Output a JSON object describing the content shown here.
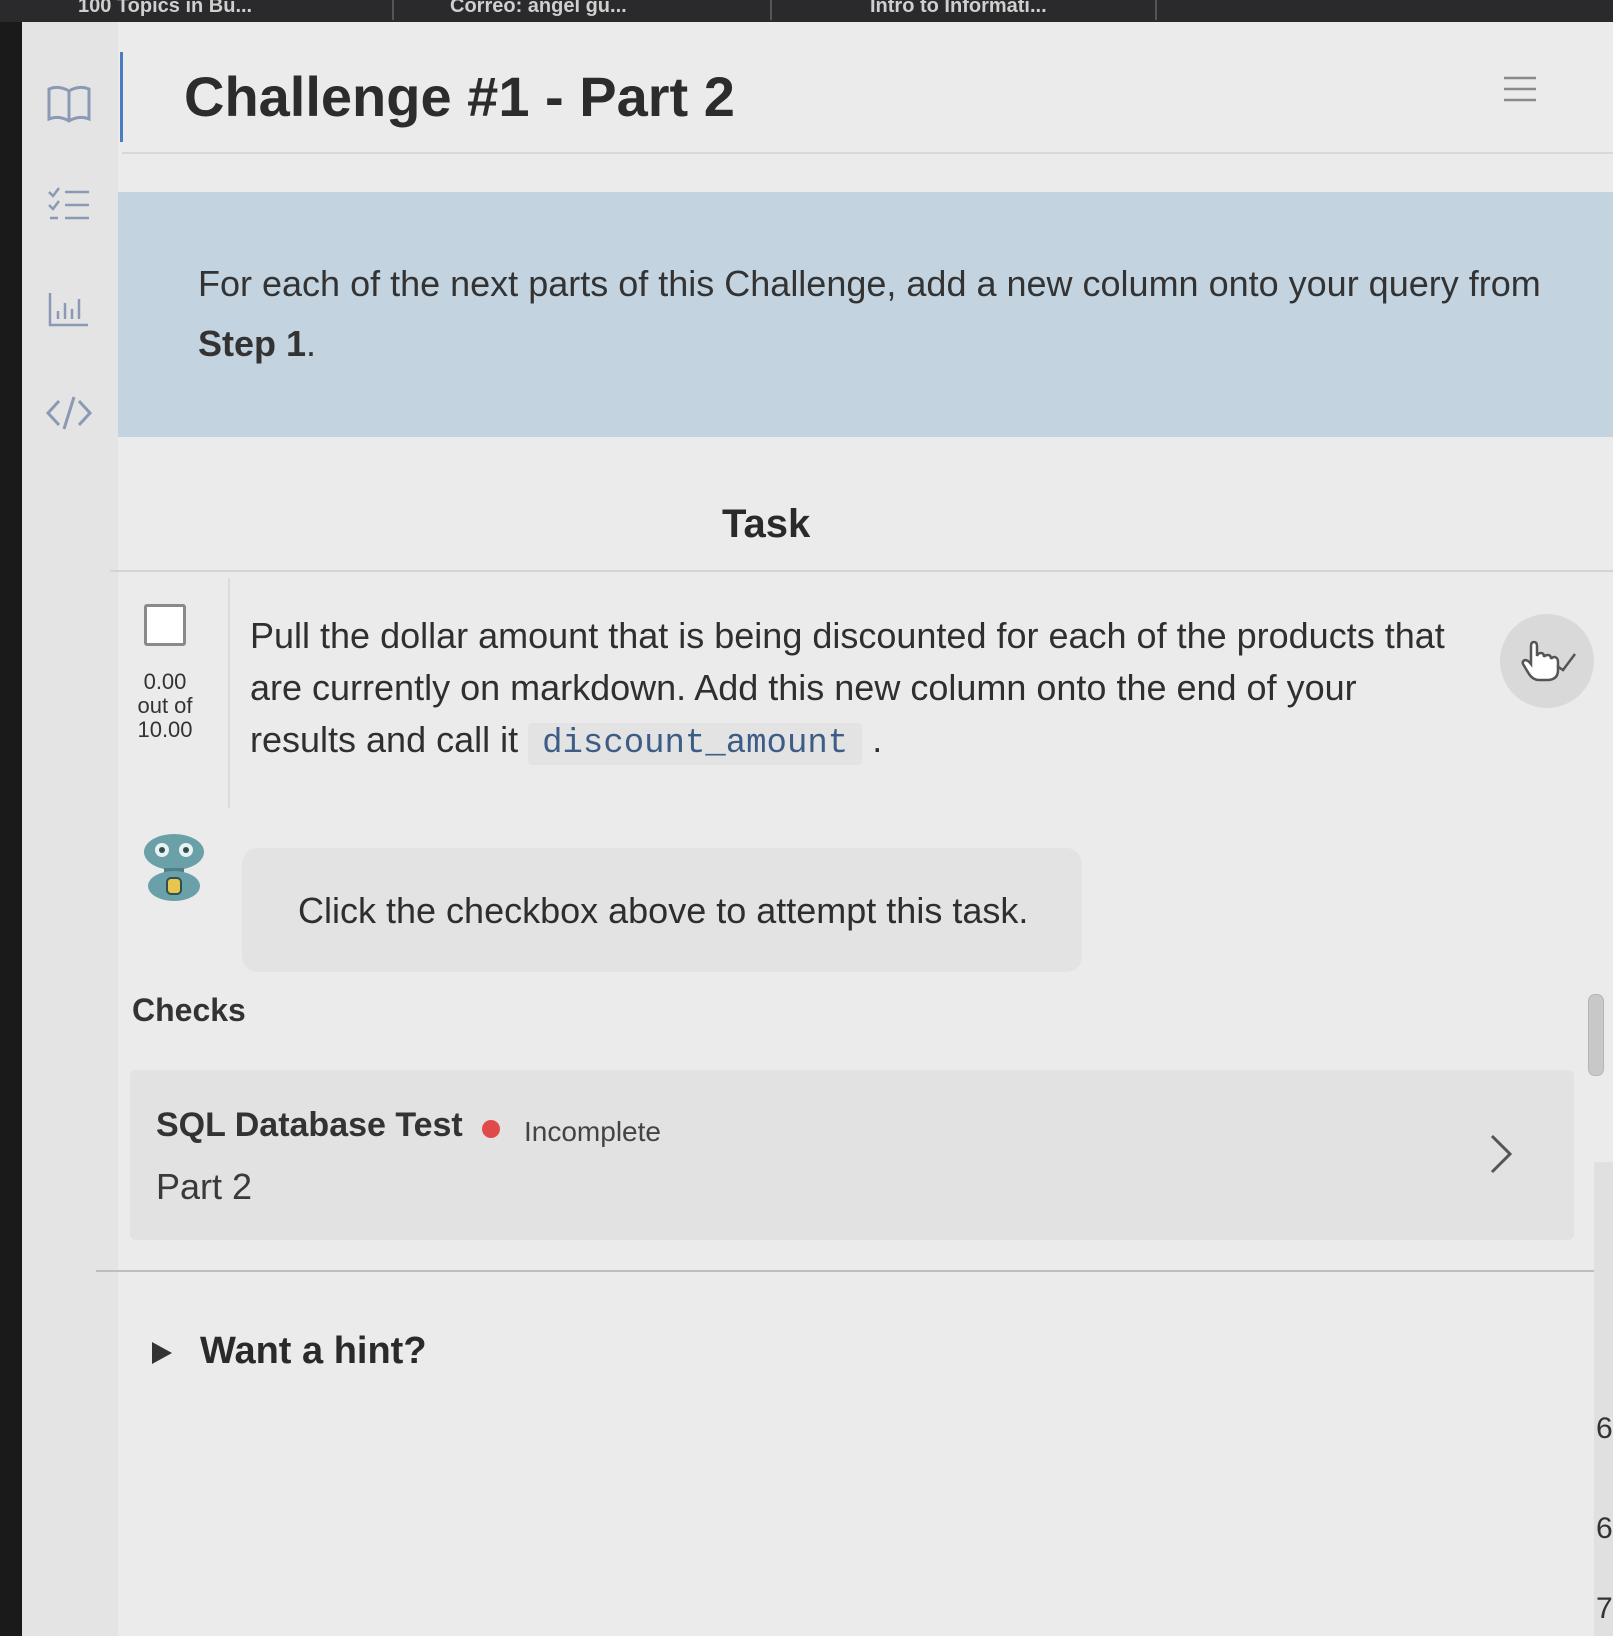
{
  "browser": {
    "tabs": [
      {
        "label": "100 Topics in Bu..."
      },
      {
        "label": "Correo: angel gu..."
      },
      {
        "label": "Intro to Informati..."
      },
      {
        "label": ""
      }
    ]
  },
  "rail": {
    "items": [
      {
        "icon": "book-icon"
      },
      {
        "icon": "checklist-icon"
      },
      {
        "icon": "bar-chart-icon"
      },
      {
        "icon": "code-icon"
      }
    ]
  },
  "header": {
    "title": "Challenge #1 - Part 2",
    "menu_icon": "hamburger-menu-icon"
  },
  "banner": {
    "text_before": "For each of the next parts of this Challenge, add a new column onto your query from ",
    "text_bold": "Step 1",
    "text_after": "."
  },
  "task": {
    "heading": "Task",
    "score_value": "0.00",
    "score_out_of": "out of",
    "score_max": "10.00",
    "text_before": "Pull the dollar amount that is being discounted for each of the products that are currently on markdown. Add this new column onto the end of your results and call it ",
    "code": "discount_amount",
    "text_after": " ."
  },
  "bot": {
    "message": "Click the checkbox above to attempt this task."
  },
  "checks": {
    "heading": "Checks",
    "items": [
      {
        "name": "SQL Database Test",
        "status": "Incomplete",
        "status_color": "#e04a4a",
        "subtitle": "Part 2"
      }
    ]
  },
  "hint": {
    "label": "Want a hint?"
  },
  "side_panel": {
    "numbers": [
      "6",
      "6",
      "7"
    ]
  }
}
